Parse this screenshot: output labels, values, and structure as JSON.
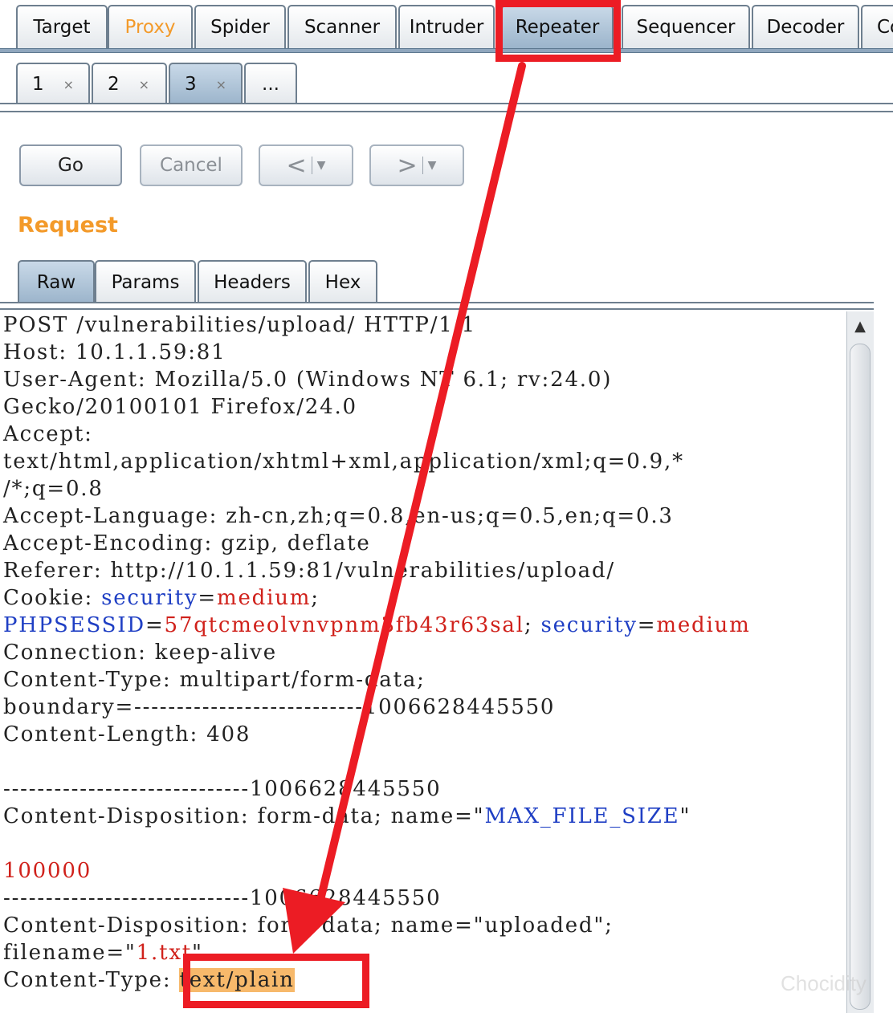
{
  "main_tabs": [
    "Target",
    "Proxy",
    "Spider",
    "Scanner",
    "Intruder",
    "Repeater",
    "Sequencer",
    "Decoder",
    "Co"
  ],
  "repeater_tabs": [
    {
      "label": "1",
      "close": "×"
    },
    {
      "label": "2",
      "close": "×"
    },
    {
      "label": "3",
      "close": "×"
    },
    {
      "label": "..."
    }
  ],
  "buttons": {
    "go": "Go",
    "cancel": "Cancel",
    "back_arrow": "<",
    "forward_arrow": ">",
    "dropdown_caret": "▼"
  },
  "request": {
    "title": "Request",
    "tabs": [
      "Raw",
      "Params",
      "Headers",
      "Hex"
    ],
    "lines": [
      "POST /vulnerabilities/upload/ HTTP/1.1",
      "Host: 10.1.1.59:81",
      "User-Agent: Mozilla/5.0 (Windows NT 6.1; rv:24.0)",
      "Gecko/20100101 Firefox/24.0",
      "Accept:",
      "text/html,application/xhtml+xml,application/xml;q=0.9,*",
      "/*;q=0.8",
      "Accept-Language: zh-cn,zh;q=0.8,en-us;q=0.5,en;q=0.3",
      "Accept-Encoding: gzip, deflate",
      "Referer: http://10.1.1.59:81/vulnerabilities/upload/",
      "Cookie: ",
      "",
      "Connection: keep-alive",
      "Content-Type: multipart/form-data;",
      "boundary=---------------------------1006628445550",
      "Content-Length: 408",
      "",
      "-----------------------------1006628445550",
      "Content-Disposition: form-data; name=\"",
      "",
      "",
      "-----------------------------1006628445550",
      "Content-Disposition: form-data; name=\"uploaded\";",
      "filename=\"",
      "Content-Type: "
    ],
    "cookie_security_key": "security",
    "cookie_security_value": "medium",
    "cookie_sep": ";",
    "phpsessid_key": "PHPSESSID",
    "phpsessid_value": "57qtcmeolvnvpnm3fb43r63sal",
    "line12_sep": "; ",
    "equals": "=",
    "max_file_size_name": "MAX_FILE_SIZE",
    "quote_close": "\"",
    "max_file_size_value": "100000",
    "filename_value": "1.txt",
    "content_type_value": "text/plain"
  },
  "watermark": "Chocidity",
  "colors": {
    "annotation": "#ec1c24",
    "accent_orange": "#f39a2a",
    "highlight": "#f7b96b",
    "param_name_blue": "#1f3fc4",
    "param_value_red": "#d0211b"
  }
}
